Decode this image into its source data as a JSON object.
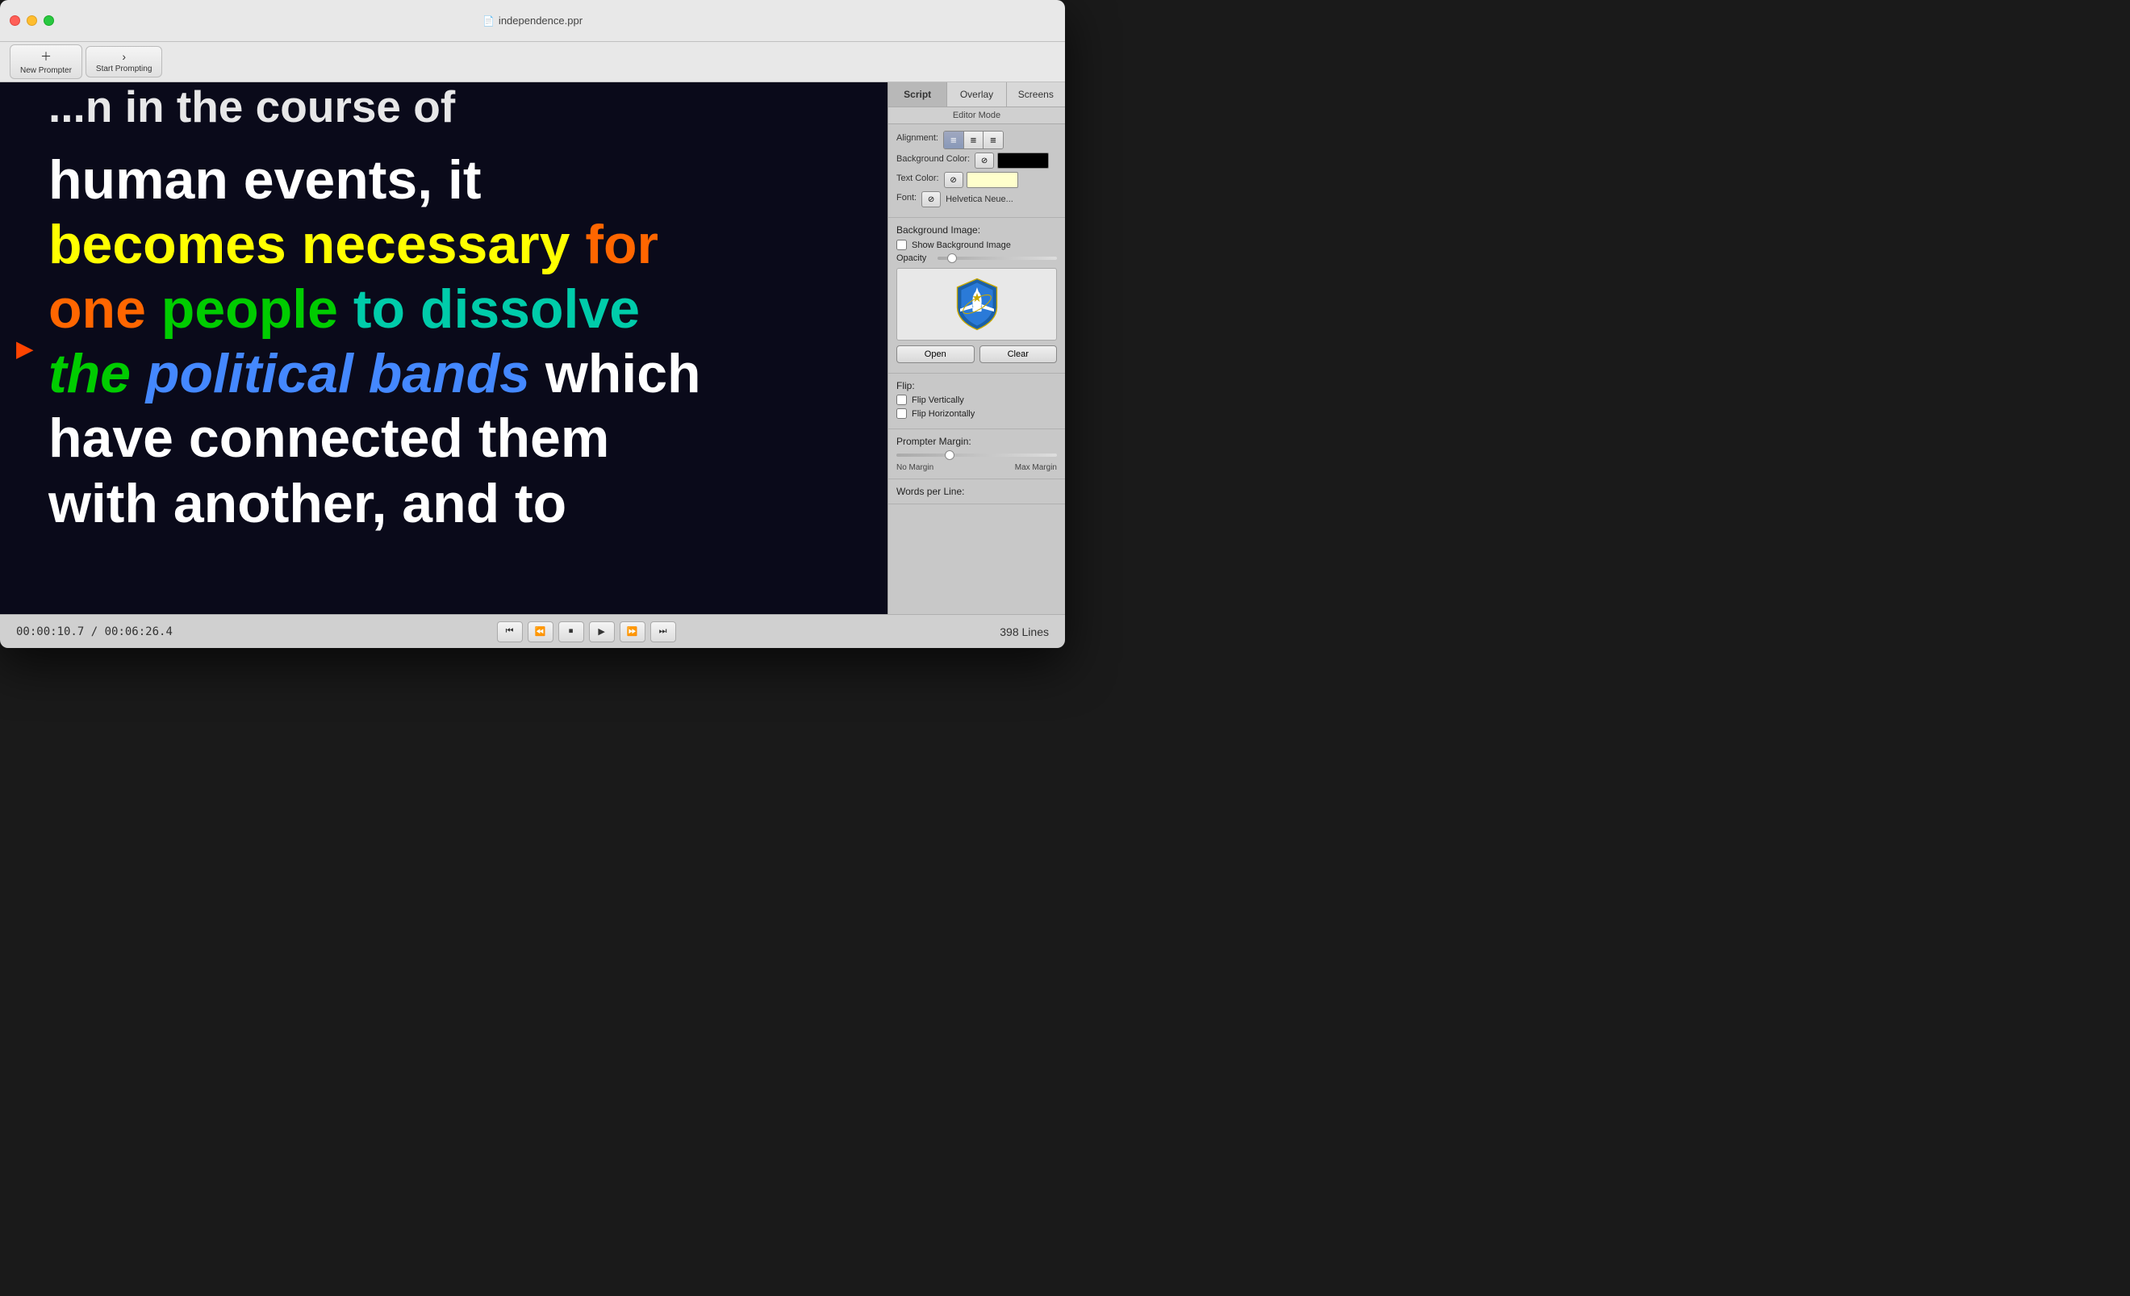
{
  "window": {
    "title": "independence.ppr"
  },
  "toolbar": {
    "new_prompter_label": "New Prompter",
    "start_prompting_label": "Start Prompting"
  },
  "tabs": {
    "script": "Script",
    "overlay": "Overlay",
    "screens": "Screens",
    "editor_mode": "Editor Mode"
  },
  "panel": {
    "alignment_label": "Alignment:",
    "bg_color_label": "Background Color:",
    "text_color_label": "Text Color:",
    "font_label": "Font:",
    "font_name": "Helvetica Neue...",
    "bg_image_label": "Background Image:",
    "show_bg_image": "Show Background Image",
    "opacity_label": "Opacity",
    "open_btn": "Open",
    "clear_btn": "Clear",
    "flip_label": "Flip:",
    "flip_vertically": "Flip Vertically",
    "flip_horizontally": "Flip Horizontally",
    "prompter_margin_label": "Prompter Margin:",
    "no_margin": "No Margin",
    "max_margin": "Max Margin",
    "words_per_line": "Words per Line:"
  },
  "prompter": {
    "partial_top": "...n in the course of",
    "line1": "human events, it",
    "line2_yellow": "becomes necessary",
    "line2_orange": " for",
    "line3_orange": "one ",
    "line3_green": "people",
    "line3_white": " to dissolve",
    "line4_green_italic": "the ",
    "line4_blue_italic": "political bands",
    "line4_white": " which",
    "line5": "have connected them",
    "line6": "with another, and to"
  },
  "status_bar": {
    "time_current": "00:00:10.7",
    "time_total": "00:06:26.4",
    "lines": "398 Lines"
  },
  "colors": {
    "bg_swatch": "#000000",
    "text_swatch": "#ffffcc",
    "accent": "#4a6eb5"
  }
}
